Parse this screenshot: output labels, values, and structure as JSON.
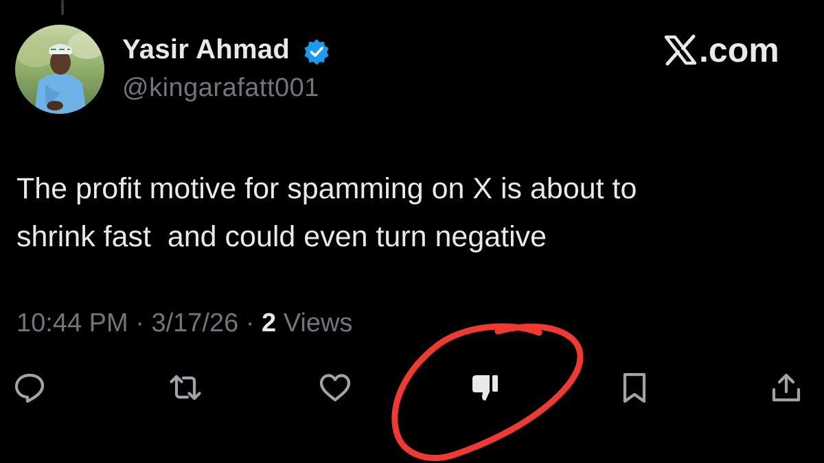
{
  "author": {
    "display_name": "Yasir Ahmad",
    "handle": "@kingarafatt001",
    "verified": true,
    "verified_color": "#1d9bf0"
  },
  "site": {
    "logo_icon": "x-logo-icon",
    "label": ".com"
  },
  "tweet": {
    "text": "The profit motive for spamming on X is about to\nshrink fast  and could even turn negative"
  },
  "meta": {
    "time": "10:44 PM",
    "separator": " · ",
    "date": "3/17/26",
    "views_count": "2",
    "views_label": " Views"
  },
  "actions": [
    {
      "name": "reply-icon"
    },
    {
      "name": "retweet-icon"
    },
    {
      "name": "like-icon"
    },
    {
      "name": "dislike-icon"
    },
    {
      "name": "bookmark-icon"
    },
    {
      "name": "share-icon"
    }
  ],
  "colors": {
    "background": "#000000",
    "text_primary": "#e7e9ea",
    "text_secondary": "#71767b",
    "annotation": "#ee3a32"
  }
}
